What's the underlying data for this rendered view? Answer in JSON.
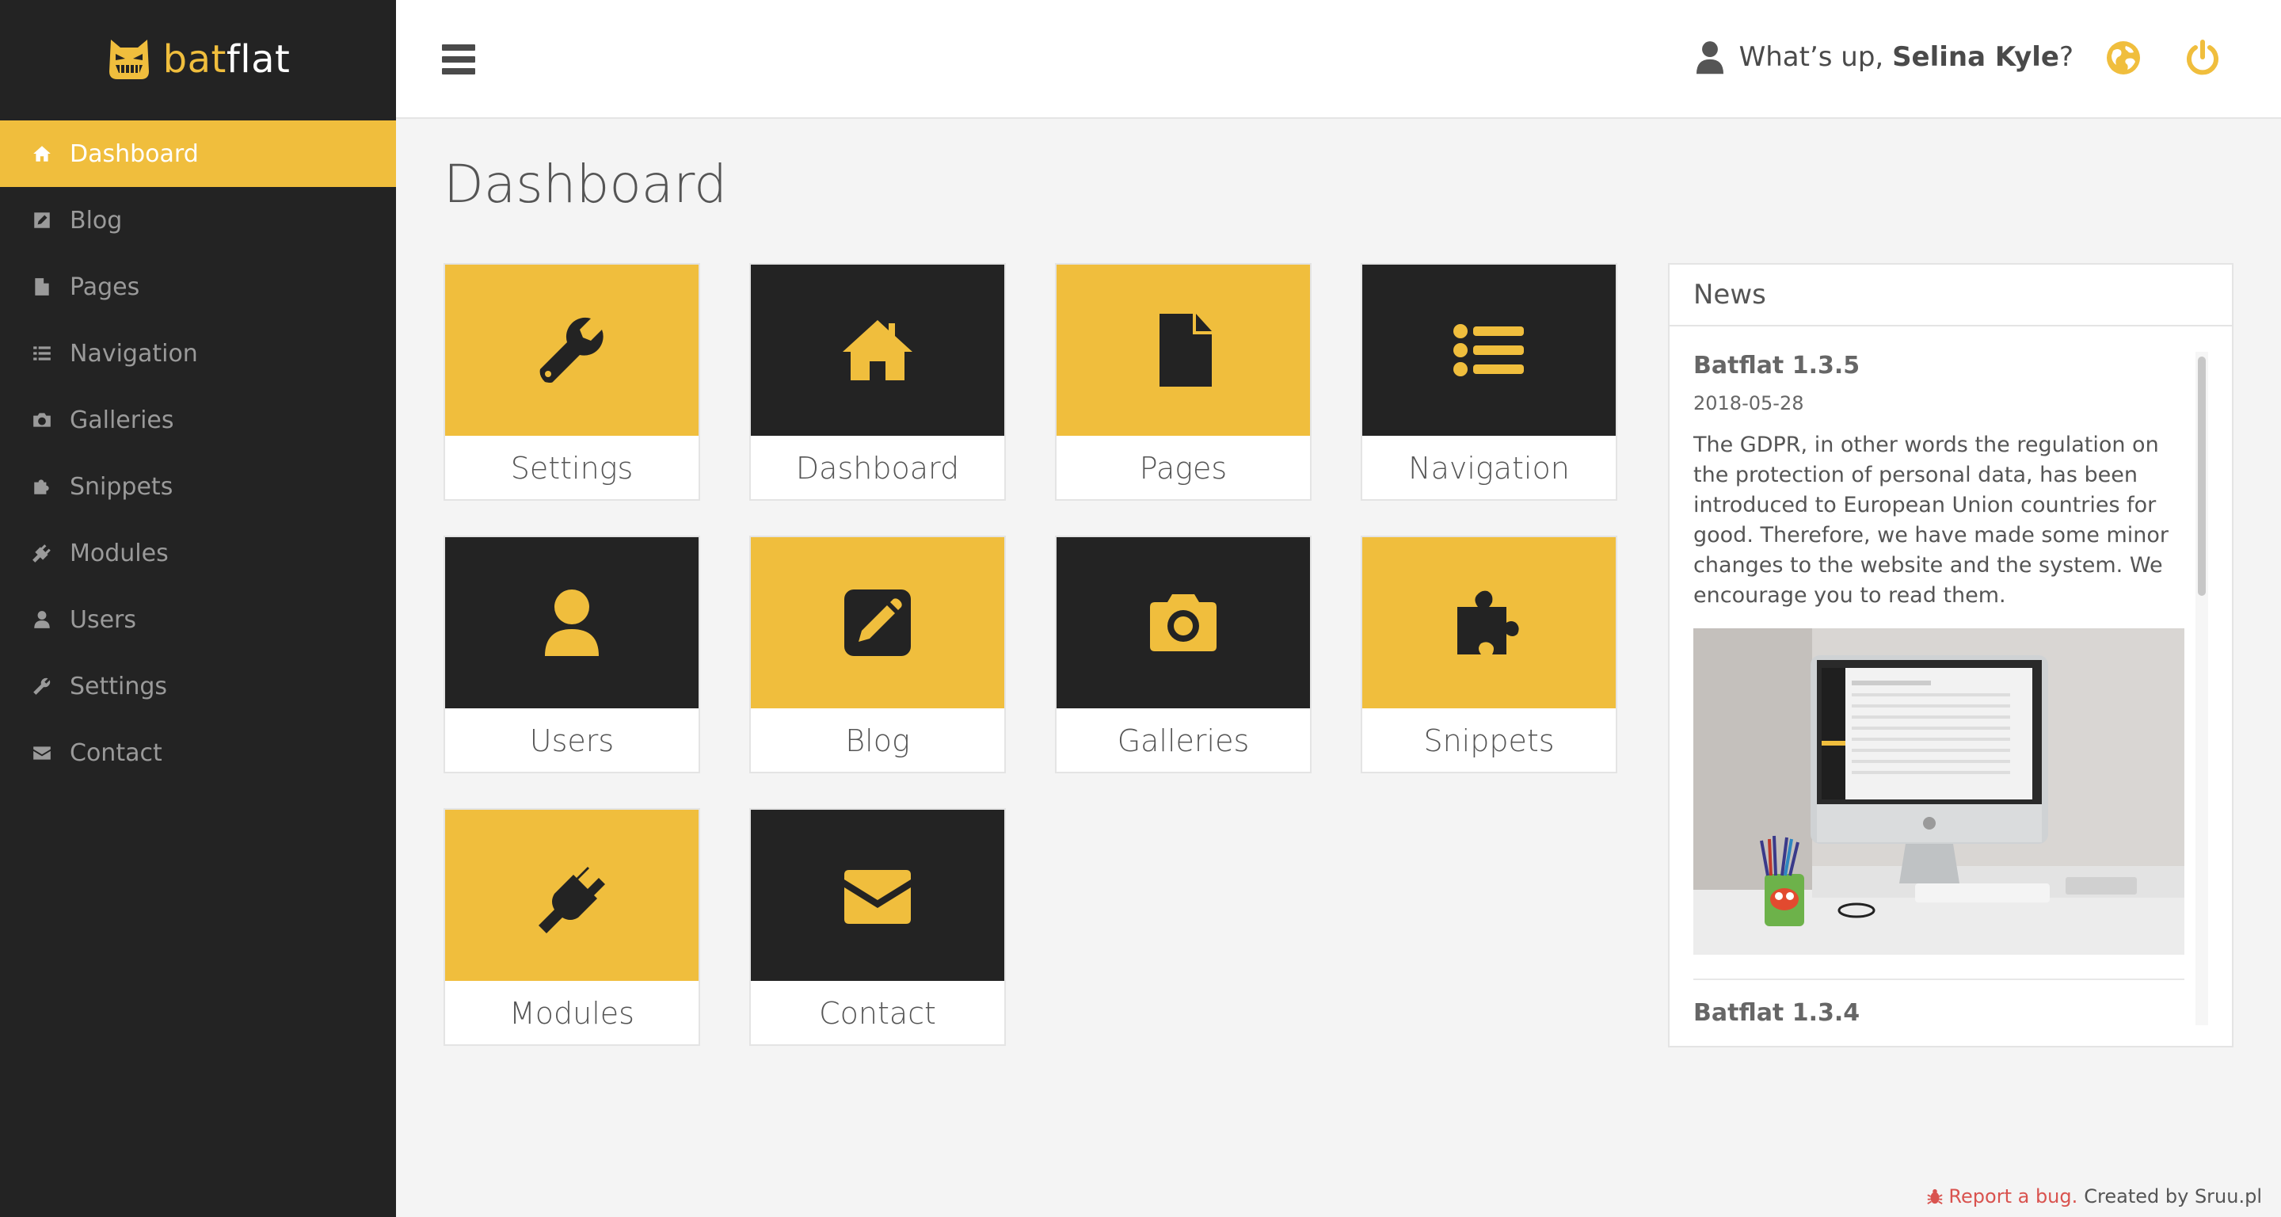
{
  "brand": {
    "prefix": "bat",
    "suffix": "flat"
  },
  "sidebar": {
    "items": [
      {
        "label": "Dashboard",
        "icon": "home-icon",
        "active": true
      },
      {
        "label": "Blog",
        "icon": "pencil-square-icon"
      },
      {
        "label": "Pages",
        "icon": "file-icon"
      },
      {
        "label": "Navigation",
        "icon": "list-icon"
      },
      {
        "label": "Galleries",
        "icon": "camera-icon"
      },
      {
        "label": "Snippets",
        "icon": "puzzle-icon"
      },
      {
        "label": "Modules",
        "icon": "plug-icon"
      },
      {
        "label": "Users",
        "icon": "user-icon"
      },
      {
        "label": "Settings",
        "icon": "wrench-icon"
      },
      {
        "label": "Contact",
        "icon": "envelope-icon"
      }
    ]
  },
  "topbar": {
    "greeting_prefix": "What’s up, ",
    "user_name": "Selina Kyle",
    "greeting_suffix": "?",
    "globe_icon": "globe-icon",
    "power_icon": "power-icon"
  },
  "page": {
    "title": "Dashboard"
  },
  "tiles": [
    {
      "label": "Settings",
      "icon": "wrench-icon",
      "style": "yellow"
    },
    {
      "label": "Dashboard",
      "icon": "home-icon",
      "style": "dark"
    },
    {
      "label": "Pages",
      "icon": "file-icon",
      "style": "yellow"
    },
    {
      "label": "Navigation",
      "icon": "list-icon",
      "style": "dark"
    },
    {
      "label": "Users",
      "icon": "user-icon",
      "style": "dark"
    },
    {
      "label": "Blog",
      "icon": "pencil-square-icon",
      "style": "yellow"
    },
    {
      "label": "Galleries",
      "icon": "camera-icon",
      "style": "dark"
    },
    {
      "label": "Snippets",
      "icon": "puzzle-icon",
      "style": "yellow"
    },
    {
      "label": "Modules",
      "icon": "plug-icon",
      "style": "yellow"
    },
    {
      "label": "Contact",
      "icon": "envelope-icon",
      "style": "dark"
    }
  ],
  "news": {
    "heading": "News",
    "items": [
      {
        "title": "Batflat 1.3.5",
        "date": "2018-05-28",
        "text": "The GDPR, in other words the regulation on the protection of personal data, has been introduced to European Union countries for good. Therefore, we have made some minor changes to the website and the system. We encourage you to read them."
      },
      {
        "title": "Batflat 1.3.4"
      }
    ]
  },
  "footer": {
    "bug_text": "Report a bug.",
    "credit": "Created by Sruu.pl"
  },
  "colors": {
    "accent": "#f0be3d",
    "dark": "#232323",
    "bug": "#d9534f"
  }
}
